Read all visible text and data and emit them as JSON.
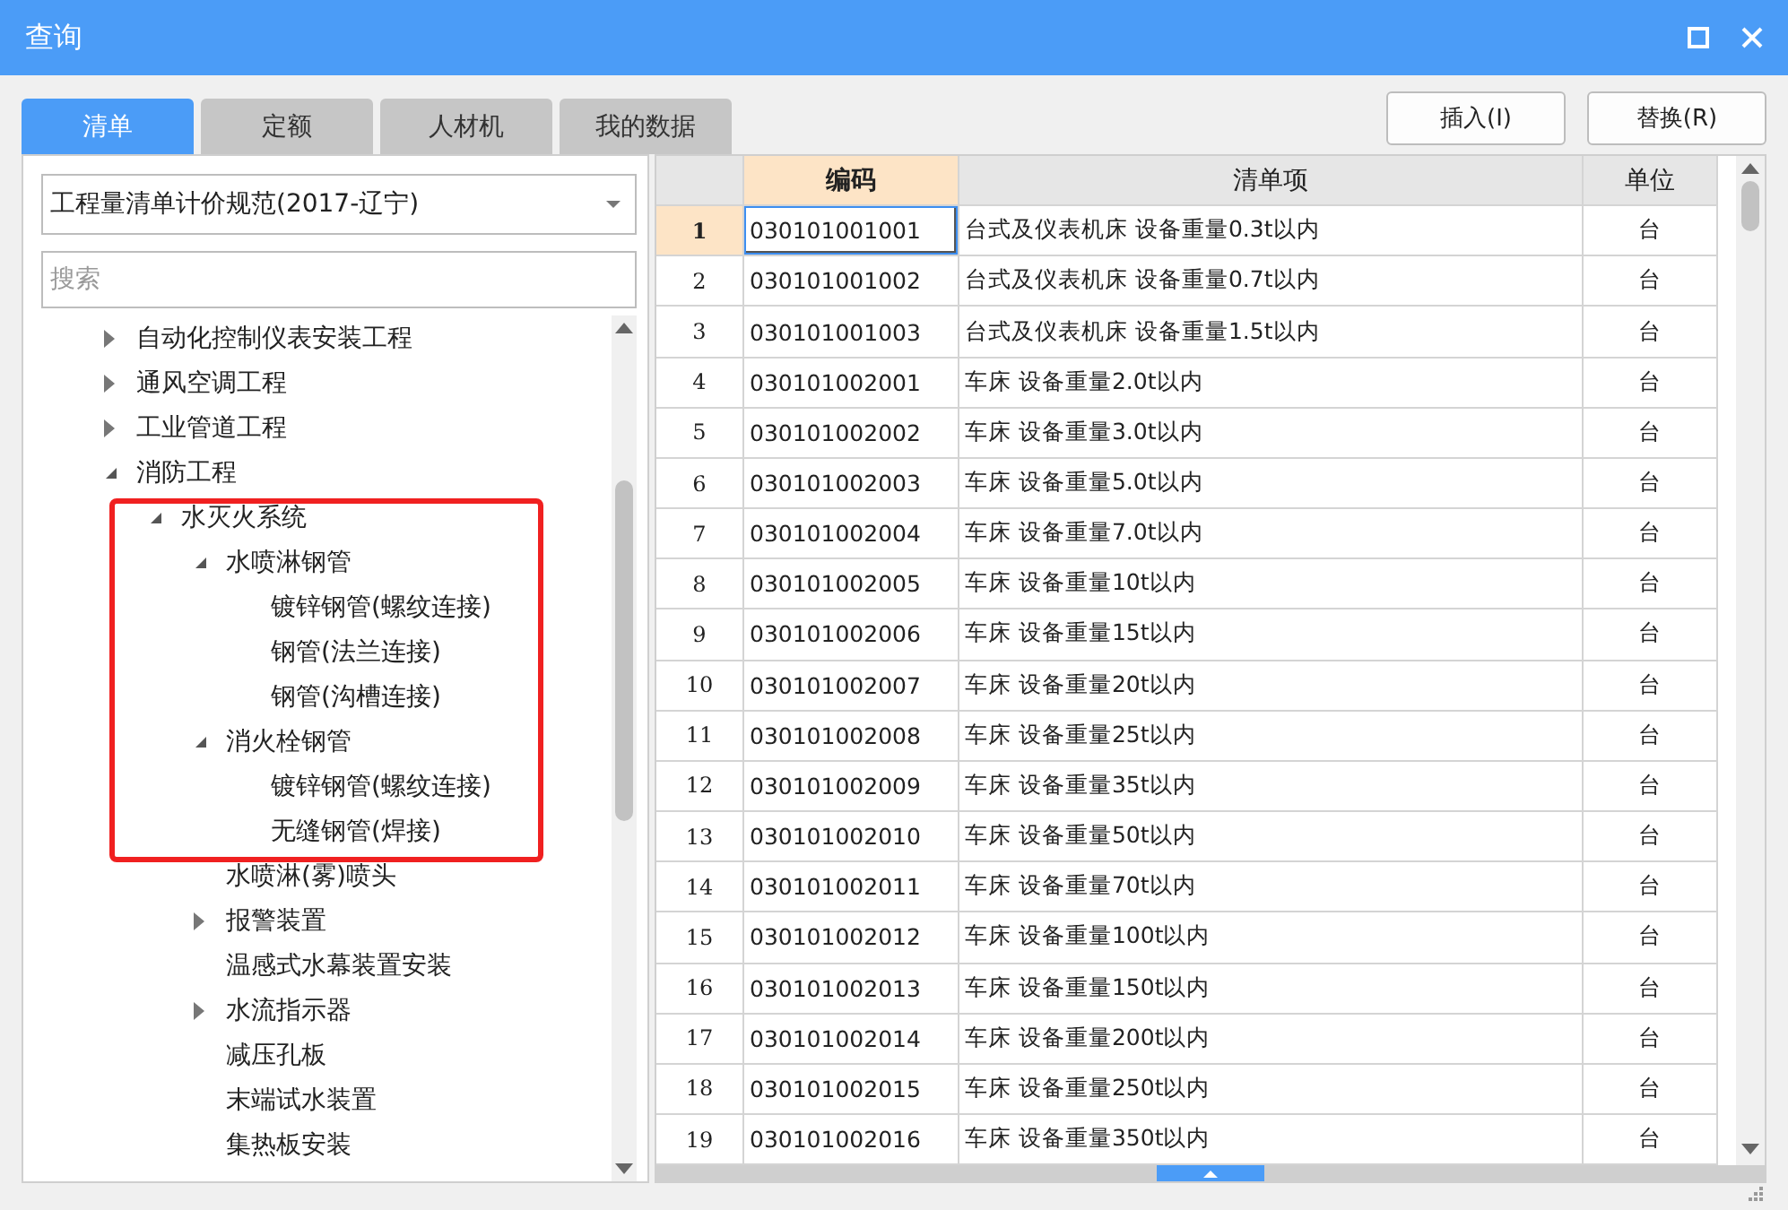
{
  "window": {
    "title": "查询"
  },
  "tabs": [
    {
      "label": "清单",
      "selected": true
    },
    {
      "label": "定额",
      "selected": false
    },
    {
      "label": "人材机",
      "selected": false
    },
    {
      "label": "我的数据",
      "selected": false
    }
  ],
  "buttons": [
    "插入(I)",
    "替换(R)"
  ],
  "library_select": {
    "value": "工程量清单计价规范(2017-辽宁)"
  },
  "search": {
    "placeholder": "搜索"
  },
  "tree": [
    {
      "label": "自动化控制仪表安装工程",
      "expanded": false
    },
    {
      "label": "通风空调工程",
      "expanded": false
    },
    {
      "label": "工业管道工程",
      "expanded": false
    },
    {
      "label": "消防工程",
      "expanded": true,
      "children": [
        {
          "label": "水灭火系统",
          "expanded": true,
          "children": [
            {
              "label": "水喷淋钢管",
              "expanded": true,
              "children": [
                {
                  "label": "镀锌钢管(螺纹连接)"
                },
                {
                  "label": "钢管(法兰连接)"
                },
                {
                  "label": "钢管(沟槽连接)"
                }
              ]
            },
            {
              "label": "消火栓钢管",
              "expanded": true,
              "children": [
                {
                  "label": "镀锌钢管(螺纹连接)"
                },
                {
                  "label": "无缝钢管(焊接)"
                }
              ]
            },
            {
              "label": "水喷淋(雾)喷头"
            },
            {
              "label": "报警装置",
              "expanded": false
            },
            {
              "label": "温感式水幕装置安装"
            },
            {
              "label": "水流指示器",
              "expanded": false
            },
            {
              "label": "减压孔板"
            },
            {
              "label": "末端试水装置"
            },
            {
              "label": "集热板安装"
            }
          ]
        }
      ]
    }
  ],
  "highlight": {
    "color": "#f02020"
  },
  "table": {
    "columns": [
      {
        "label": "编码",
        "selected": true
      },
      {
        "label": "清单项",
        "selected": false
      },
      {
        "label": "单位",
        "selected": false
      }
    ],
    "rows": [
      {
        "number": "1",
        "code": "030101001001",
        "item": "台式及仪表机床 设备重量0.3t以内",
        "unit": "台",
        "selected": true
      },
      {
        "number": "2",
        "code": "030101001002",
        "item": "台式及仪表机床 设备重量0.7t以内",
        "unit": "台",
        "selected": false
      },
      {
        "number": "3",
        "code": "030101001003",
        "item": "台式及仪表机床 设备重量1.5t以内",
        "unit": "台",
        "selected": false
      },
      {
        "number": "4",
        "code": "030101002001",
        "item": "车床 设备重量2.0t以内",
        "unit": "台",
        "selected": false
      },
      {
        "number": "5",
        "code": "030101002002",
        "item": "车床 设备重量3.0t以内",
        "unit": "台",
        "selected": false
      },
      {
        "number": "6",
        "code": "030101002003",
        "item": "车床 设备重量5.0t以内",
        "unit": "台",
        "selected": false
      },
      {
        "number": "7",
        "code": "030101002004",
        "item": "车床 设备重量7.0t以内",
        "unit": "台",
        "selected": false
      },
      {
        "number": "8",
        "code": "030101002005",
        "item": "车床 设备重量10t以内",
        "unit": "台",
        "selected": false
      },
      {
        "number": "9",
        "code": "030101002006",
        "item": "车床 设备重量15t以内",
        "unit": "台",
        "selected": false
      },
      {
        "number": "10",
        "code": "030101002007",
        "item": "车床 设备重量20t以内",
        "unit": "台",
        "selected": false
      },
      {
        "number": "11",
        "code": "030101002008",
        "item": "车床 设备重量25t以内",
        "unit": "台",
        "selected": false
      },
      {
        "number": "12",
        "code": "030101002009",
        "item": "车床 设备重量35t以内",
        "unit": "台",
        "selected": false
      },
      {
        "number": "13",
        "code": "030101002010",
        "item": "车床 设备重量50t以内",
        "unit": "台",
        "selected": false
      },
      {
        "number": "14",
        "code": "030101002011",
        "item": "车床 设备重量70t以内",
        "unit": "台",
        "selected": false
      },
      {
        "number": "15",
        "code": "030101002012",
        "item": "车床 设备重量100t以内",
        "unit": "台",
        "selected": false
      },
      {
        "number": "16",
        "code": "030101002013",
        "item": "车床 设备重量150t以内",
        "unit": "台",
        "selected": false
      },
      {
        "number": "17",
        "code": "030101002014",
        "item": "车床 设备重量200t以内",
        "unit": "台",
        "selected": false
      },
      {
        "number": "18",
        "code": "030101002015",
        "item": "车床 设备重量250t以内",
        "unit": "台",
        "selected": false
      },
      {
        "number": "19",
        "code": "030101002016",
        "item": "车床 设备重量350t以内",
        "unit": "台",
        "selected": false
      }
    ]
  }
}
